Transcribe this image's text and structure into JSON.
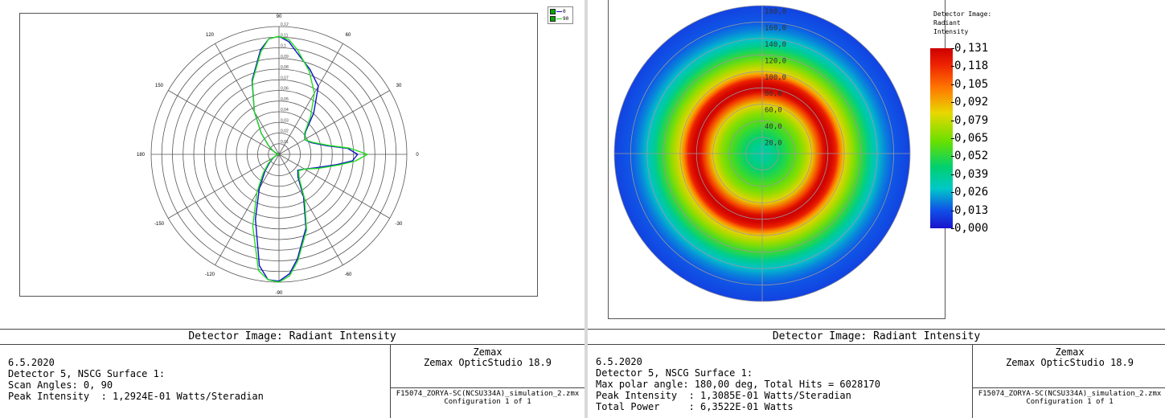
{
  "left_window": {
    "footer": {
      "title": "Detector Image: Radiant Intensity",
      "info_lines": [
        "6.5.2020",
        "Detector 5, NSCG Surface 1:",
        "Scan Angles: 0, 90",
        "Peak Intensity  : 1,2924E-01 Watts/Steradian"
      ],
      "brand": "Zemax",
      "product": "Zemax OpticStudio 18.9",
      "file": "F15074_ZORYA-SC(NCSU334A)_simulation_2.zmx",
      "config": "Configuration 1 of 1"
    }
  },
  "right_window": {
    "footer": {
      "title": "Detector Image: Radiant Intensity",
      "info_lines": [
        "6.5.2020",
        "Detector 5, NSCG Surface 1:",
        "Max polar angle: 180,00 deg, Total Hits = 6028170",
        "Peak Intensity  : 1,3085E-01 Watts/Steradian",
        "Total Power     : 6,3522E-01 Watts"
      ],
      "brand": "Zemax",
      "product": "Zemax OpticStudio 18.9",
      "file": "F15074_ZORYA-SC(NCSU334A)_simulation_2.zmx",
      "config": "Configuration 1 of 1"
    }
  },
  "chart_data": [
    {
      "type": "line",
      "polar": true,
      "grid": true,
      "legend_position": "top-right",
      "angle_labels": [
        {
          "deg": 90,
          "label": "90"
        },
        {
          "deg": 60,
          "label": "60"
        },
        {
          "deg": 30,
          "label": "30"
        },
        {
          "deg": 0,
          "label": "0"
        },
        {
          "deg": -30,
          "label": "-30"
        },
        {
          "deg": -60,
          "label": "-60"
        },
        {
          "deg": -90,
          "label": "-90"
        },
        {
          "deg": -120,
          "label": "-120"
        },
        {
          "deg": -150,
          "label": "-150"
        },
        {
          "deg": 180,
          "label": "180"
        },
        {
          "deg": 150,
          "label": "150"
        },
        {
          "deg": 120,
          "label": "120"
        }
      ],
      "radius_max": 0.13,
      "radial_labels": [
        "0,01",
        "0,02",
        "0,03",
        "0,04",
        "0,05",
        "0,06",
        "0,07",
        "0,08",
        "0,09",
        "0,1",
        "0,11",
        "0,12"
      ],
      "colors": [
        "#1010cc",
        "#22dd22"
      ],
      "series": [
        {
          "name": "0",
          "angles": [
            -180,
            -170,
            -160,
            -150,
            -140,
            -130,
            -120,
            -110,
            -100,
            -95,
            -90,
            -85,
            -80,
            -70,
            -60,
            -50,
            -40,
            -30,
            -20,
            -10,
            -5,
            0,
            5,
            10,
            20,
            30,
            40,
            50,
            60,
            70,
            80,
            85,
            90,
            95,
            100,
            110,
            120,
            130,
            140,
            150,
            160,
            170,
            180
          ],
          "values": [
            0.0,
            0.001,
            0.003,
            0.006,
            0.012,
            0.022,
            0.04,
            0.07,
            0.115,
            0.128,
            0.129,
            0.122,
            0.108,
            0.08,
            0.05,
            0.03,
            0.025,
            0.03,
            0.04,
            0.06,
            0.075,
            0.08,
            0.07,
            0.05,
            0.035,
            0.03,
            0.035,
            0.055,
            0.08,
            0.092,
            0.105,
            0.115,
            0.12,
            0.118,
            0.108,
            0.08,
            0.05,
            0.028,
            0.014,
            0.007,
            0.003,
            0.001,
            0.0
          ]
        },
        {
          "name": "90",
          "angles": [
            -180,
            -170,
            -160,
            -150,
            -140,
            -130,
            -120,
            -110,
            -100,
            -95,
            -90,
            -85,
            -80,
            -70,
            -60,
            -50,
            -40,
            -30,
            -20,
            -10,
            -5,
            0,
            5,
            10,
            20,
            30,
            40,
            50,
            60,
            70,
            80,
            85,
            90,
            95,
            100,
            110,
            120,
            130,
            140,
            150,
            160,
            170,
            180
          ],
          "values": [
            0.0,
            0.001,
            0.003,
            0.007,
            0.014,
            0.025,
            0.045,
            0.078,
            0.12,
            0.128,
            0.13,
            0.124,
            0.11,
            0.082,
            0.052,
            0.032,
            0.026,
            0.03,
            0.042,
            0.062,
            0.078,
            0.09,
            0.072,
            0.052,
            0.036,
            0.03,
            0.034,
            0.05,
            0.072,
            0.09,
            0.108,
            0.117,
            0.12,
            0.118,
            0.106,
            0.079,
            0.05,
            0.028,
            0.014,
            0.007,
            0.003,
            0.001,
            0.0
          ]
        }
      ]
    },
    {
      "type": "heatmap",
      "polar": true,
      "title": "Detector Image:\nRadiant\nIntensity",
      "radial_labels": [
        "20,0",
        "40,0",
        "60,0",
        "80,0",
        "100,0",
        "120,0",
        "140,0",
        "160,0",
        "180,0"
      ],
      "radius_max": 180,
      "colorbar_ticks": [
        "0,131",
        "0,118",
        "0,105",
        "0,092",
        "0,079",
        "0,065",
        "0,052",
        "0,039",
        "0,026",
        "0,013",
        "0,000"
      ],
      "value_range": [
        0.0,
        0.131
      ],
      "radial_profile": {
        "polar_angle_deg": [
          0,
          10,
          20,
          30,
          40,
          50,
          60,
          70,
          75,
          80,
          85,
          90,
          95,
          100,
          110,
          120,
          130,
          140,
          150,
          160,
          180
        ],
        "intensity": [
          0.035,
          0.038,
          0.045,
          0.052,
          0.06,
          0.07,
          0.085,
          0.112,
          0.126,
          0.131,
          0.128,
          0.12,
          0.1,
          0.085,
          0.07,
          0.055,
          0.04,
          0.028,
          0.02,
          0.014,
          0.01
        ]
      }
    }
  ]
}
